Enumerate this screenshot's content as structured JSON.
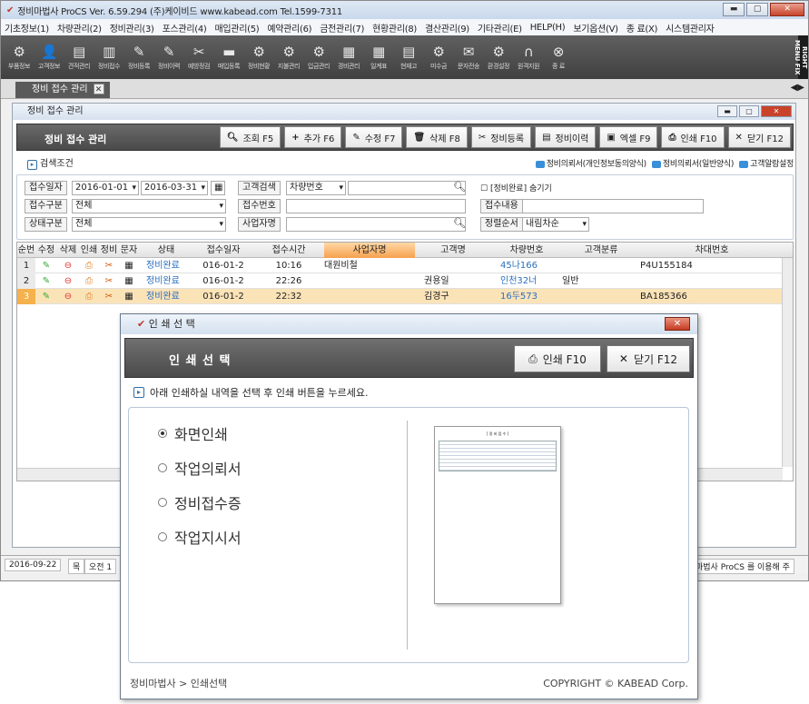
{
  "app": {
    "title": "정비마법사 ProCS  Ver. 6.59.294  (주)케이비드  www.kabead.com  Tel.1599-7311"
  },
  "menu": [
    "기초정보(1)",
    "차량관리(2)",
    "정비관리(3)",
    "포스관리(4)",
    "매입관리(5)",
    "예약관리(6)",
    "금전관리(7)",
    "현황관리(8)",
    "결산관리(9)",
    "기타관리(E)",
    "HELP(H)",
    "보기옵션(V)",
    "종 료(X)",
    "시스템관리자"
  ],
  "toolbar": [
    "부품정보",
    "고객정보",
    "견적관리",
    "정비접수",
    "정비등록",
    "정비이력",
    "예방정검",
    "매입등록",
    "정비현황",
    "지불관리",
    "입금관리",
    "경비관리",
    "일계표",
    "현재고",
    "미수금",
    "문자전송",
    "환경설정",
    "원격지원",
    "종 료"
  ],
  "rightmenu": "RIGHT MENU FIX",
  "tab": {
    "label": "정비 접수 관리"
  },
  "window": {
    "title": "정비 접수 관리",
    "header": "정비 접수 관리",
    "buttons": {
      "search": "조회 F5",
      "add": "추가 F6",
      "edit": "수정 F7",
      "delete": "삭제 F8",
      "register": "정비등록",
      "history": "정비이력",
      "excel": "엑셀 F9",
      "print": "인쇄 F10",
      "close": "닫기 F12"
    }
  },
  "search": {
    "heading": "검색조건",
    "links": [
      "정비의뢰서(개인정보동의양식)",
      "정비의뢰서(일반양식)",
      "고객알람설정"
    ],
    "date_label": "접수일자",
    "date_from": "2016-01-01",
    "date_to": "2016-03-31",
    "cust_label": "고객검색",
    "cust_sel": "차량번호",
    "hide_label": "[정비완료] 숨기기",
    "type_label": "접수구분",
    "type_val": "전체",
    "no_label": "접수번호",
    "content_label": "접수내용",
    "status_label": "상태구분",
    "status_val": "전체",
    "biz_label": "사업자명",
    "sort_label": "정렬순서",
    "sort_val": "내림차순"
  },
  "grid": {
    "headers": [
      "순번",
      "수정",
      "삭제",
      "인쇄",
      "정비",
      "문자",
      "상태",
      "접수일자",
      "접수시간",
      "사업자명",
      "고객명",
      "차량번호",
      "고객분류",
      "차대번호"
    ],
    "rows": [
      {
        "no": "1",
        "status": "정비완료",
        "date": "016-01-2",
        "time": "10:16",
        "biz": "대원비철",
        "cust": "",
        "car": "45나166",
        "cls": "",
        "vin": "P4U155184"
      },
      {
        "no": "2",
        "status": "정비완료",
        "date": "016-01-2",
        "time": "22:26",
        "biz": "",
        "cust": "권용일",
        "car": "인천32너",
        "cls": "일반",
        "vin": ""
      },
      {
        "no": "3",
        "status": "정비완료",
        "date": "016-01-2",
        "time": "22:32",
        "biz": "",
        "cust": "김경구",
        "car": "16두573",
        "cls": "",
        "vin": "BA185366"
      }
    ]
  },
  "status": {
    "date": "2016-09-22",
    "day": "목",
    "time": "오전 1",
    "msg": "마법사 ProCS 를 이용해 주"
  },
  "dialog": {
    "title": "인 쇄 선 택",
    "header": "인 쇄 선 택",
    "print": "인쇄 F10",
    "close": "닫기 F12",
    "info": "아래 인쇄하실 내역을 선택 후 인쇄 버튼을 누르세요.",
    "options": [
      "화면인쇄",
      "작업의뢰서",
      "정비접수증",
      "작업지시서"
    ],
    "preview_title": "[ 정 비 접 수 ]",
    "breadcrumb": "정비마법사 > 인쇄선택",
    "copyright": "COPYRIGHT © KABEAD Corp."
  }
}
